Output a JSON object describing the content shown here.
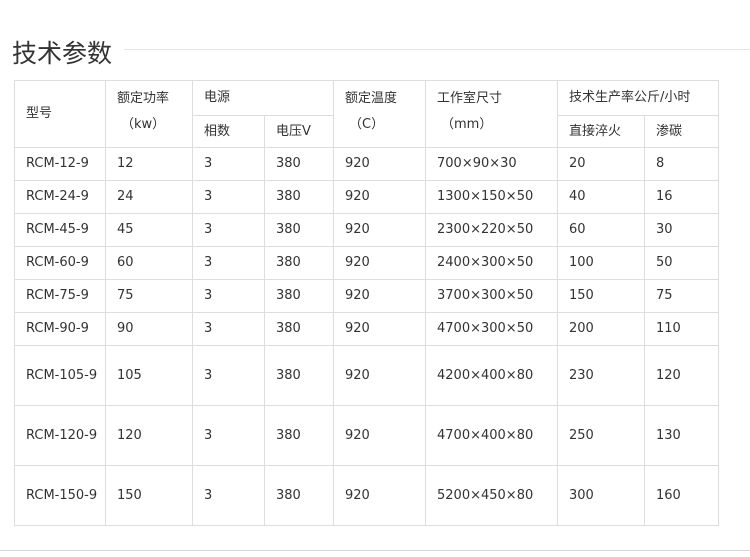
{
  "heading": "技术参数",
  "header": {
    "model": "型号",
    "power": "额定功率",
    "power_unit": "（kw）",
    "supply": "电源",
    "phases": "相数",
    "voltage": "电压V",
    "temp": "额定温度",
    "temp_unit": "（C）",
    "chamber": "工作室尺寸",
    "chamber_unit": "（mm）",
    "productivity": "技术生产率公斤/小时",
    "quench": "直接淬火",
    "carburize": "渗碳"
  },
  "rows": [
    {
      "model": "RCM-12-9",
      "power": "12",
      "phases": "3",
      "voltage": "380",
      "temp": "920",
      "size": "700×90×30",
      "quench": "20",
      "carburize": "8"
    },
    {
      "model": "RCM-24-9",
      "power": "24",
      "phases": "3",
      "voltage": "380",
      "temp": "920",
      "size": "1300×150×50",
      "quench": "40",
      "carburize": "16"
    },
    {
      "model": "RCM-45-9",
      "power": "45",
      "phases": "3",
      "voltage": "380",
      "temp": "920",
      "size": "2300×220×50",
      "quench": "60",
      "carburize": "30"
    },
    {
      "model": "RCM-60-9",
      "power": "60",
      "phases": "3",
      "voltage": "380",
      "temp": "920",
      "size": "2400×300×50",
      "quench": "100",
      "carburize": "50"
    },
    {
      "model": "RCM-75-9",
      "power": "75",
      "phases": "3",
      "voltage": "380",
      "temp": "920",
      "size": "3700×300×50",
      "quench": "150",
      "carburize": "75"
    },
    {
      "model": "RCM-90-9",
      "power": "90",
      "phases": "3",
      "voltage": "380",
      "temp": "920",
      "size": "4700×300×50",
      "quench": "200",
      "carburize": "110"
    },
    {
      "model": "RCM-105-9",
      "power": "105",
      "phases": "3",
      "voltage": "380",
      "temp": "920",
      "size": "4200×400×80",
      "quench": "230",
      "carburize": "120"
    },
    {
      "model": "RCM-120-9",
      "power": "120",
      "phases": "3",
      "voltage": "380",
      "temp": "920",
      "size": "4700×400×80",
      "quench": "250",
      "carburize": "130"
    },
    {
      "model": "RCM-150-9",
      "power": "150",
      "phases": "3",
      "voltage": "380",
      "temp": "920",
      "size": "5200×450×80",
      "quench": "300",
      "carburize": "160"
    }
  ]
}
